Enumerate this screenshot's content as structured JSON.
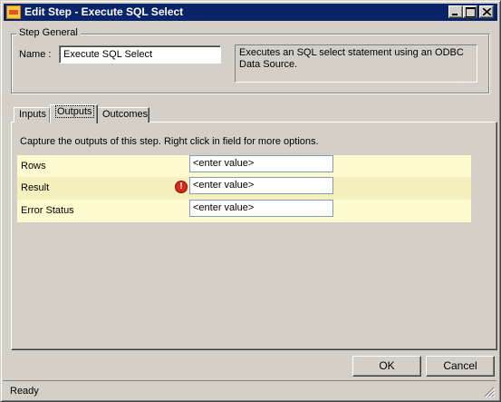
{
  "window": {
    "title": "Edit Step - Execute SQL Select",
    "icon": "sql-step-icon"
  },
  "step_general": {
    "legend": "Step General",
    "name_label": "Name :",
    "name_value": "Execute SQL Select",
    "description": "Executes an SQL select statement using an ODBC Data Source."
  },
  "tabs": [
    {
      "label": "Inputs"
    },
    {
      "label": "Outputs"
    },
    {
      "label": "Outcomes"
    }
  ],
  "outputs_panel": {
    "instructions": "Capture the outputs of this step.  Right click in field for more options.",
    "rows": [
      {
        "label": "Rows",
        "value": "<enter value>"
      },
      {
        "label": "Result",
        "value": "<enter value>"
      },
      {
        "label": "Error Status",
        "value": "<enter value>"
      }
    ]
  },
  "buttons": {
    "ok": "OK",
    "cancel": "Cancel"
  },
  "status": {
    "text": "Ready"
  }
}
